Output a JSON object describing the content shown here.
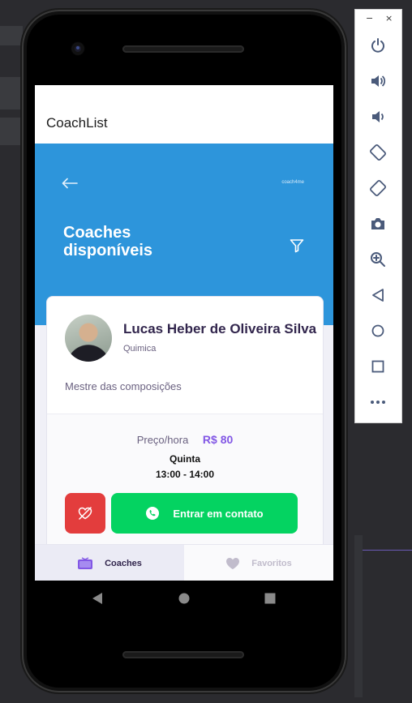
{
  "app": {
    "title": "CoachList"
  },
  "hero": {
    "logo": "coach4me",
    "title": "Coaches disponíveis"
  },
  "coach": {
    "name": "Lucas Heber de Oliveira Silva",
    "subject": "Quimica",
    "bio": "Mestre das composições",
    "price_label": "Preço/hora",
    "price_value": "R$ 80",
    "day": "Quinta",
    "time": "13:00 - 14:00",
    "contact_label": "Entrar em contato"
  },
  "tabs": [
    {
      "label": "Coaches",
      "icon": "tv-icon",
      "active": true
    },
    {
      "label": "Favoritos",
      "icon": "heart-icon",
      "active": false
    }
  ],
  "emulator": {
    "minimize": "−",
    "close": "×",
    "buttons": [
      "power-icon",
      "volume-up-icon",
      "volume-down-icon",
      "rotate-left-icon",
      "rotate-right-icon",
      "camera-icon",
      "zoom-icon",
      "back-icon",
      "home-icon",
      "overview-icon",
      "more-icon"
    ]
  },
  "colors": {
    "hero": "#2d95db",
    "accent": "#8257e5",
    "contact": "#04d361",
    "favorite": "#e33d3d"
  }
}
